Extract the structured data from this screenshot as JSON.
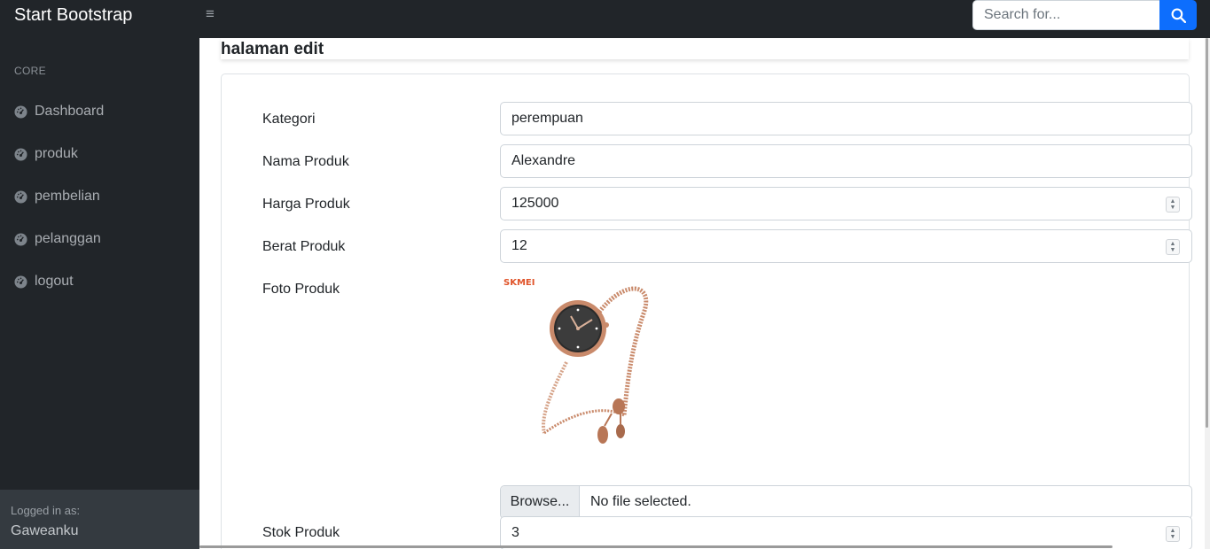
{
  "navbar": {
    "brand": "Start Bootstrap",
    "toggle_icon": "≡",
    "search_placeholder": "Search for...",
    "search_button_icon": "search-icon",
    "search_button_color": "#0d6efd"
  },
  "sidebar": {
    "heading": "CORE",
    "items": [
      {
        "label": "Dashboard",
        "icon": "tachometer-icon"
      },
      {
        "label": "produk",
        "icon": "tachometer-icon"
      },
      {
        "label": "pembelian",
        "icon": "tachometer-icon"
      },
      {
        "label": "pelanggan",
        "icon": "tachometer-icon"
      },
      {
        "label": "logout",
        "icon": "tachometer-icon"
      }
    ],
    "footer": {
      "small": "Logged in as:",
      "user": "Gaweanku"
    }
  },
  "main": {
    "page_title": "halaman edit",
    "form": {
      "kategori": {
        "label": "Kategori",
        "value": "perempuan"
      },
      "nama": {
        "label": "Nama Produk",
        "value": "Alexandre"
      },
      "harga": {
        "label": "Harga Produk",
        "value": "125000"
      },
      "berat": {
        "label": "Berat Produk",
        "value": "12"
      },
      "foto": {
        "label": "Foto Produk",
        "image_logo_text": "SKMEI",
        "browse_label": "Browse...",
        "file_status": "No file selected."
      },
      "stok": {
        "label": "Stok Produk",
        "value": "3"
      },
      "submit_button_color": "#198754"
    }
  },
  "colors": {
    "dark_background": "#212529",
    "sidebar_footer": "#343a40",
    "accent": "#0d6efd"
  }
}
